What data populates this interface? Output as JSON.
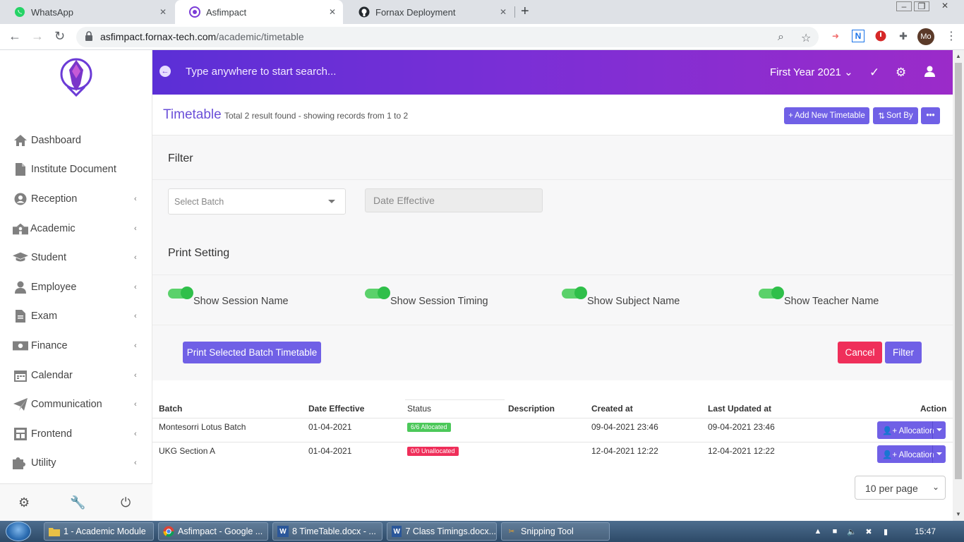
{
  "browser": {
    "tabs": [
      {
        "title": "WhatsApp",
        "icon": "whatsapp-icon"
      },
      {
        "title": "Asfimpact",
        "icon": "asfimpact-icon"
      },
      {
        "title": "Fornax Deployment",
        "icon": "github-icon"
      }
    ],
    "url_domain": "asfimpact.fornax-tech.com",
    "url_path": "/academic/timetable",
    "profile_initials": "Mo"
  },
  "topbar": {
    "search_placeholder": "Type anywhere to start search...",
    "year": "First Year 2021"
  },
  "sidebar": {
    "items": [
      {
        "label": "Dashboard",
        "icon": "home-icon",
        "has_submenu": false
      },
      {
        "label": "Institute Document",
        "icon": "document-icon",
        "has_submenu": false
      },
      {
        "label": "Reception",
        "icon": "user-circle-icon",
        "has_submenu": true
      },
      {
        "label": "Academic",
        "icon": "school-icon",
        "has_submenu": true
      },
      {
        "label": "Student",
        "icon": "graduation-cap-icon",
        "has_submenu": true
      },
      {
        "label": "Employee",
        "icon": "user-tie-icon",
        "has_submenu": true
      },
      {
        "label": "Exam",
        "icon": "file-icon",
        "has_submenu": true
      },
      {
        "label": "Finance",
        "icon": "money-icon",
        "has_submenu": true
      },
      {
        "label": "Calendar",
        "icon": "calendar-icon",
        "has_submenu": true
      },
      {
        "label": "Communication",
        "icon": "paper-plane-icon",
        "has_submenu": true
      },
      {
        "label": "Frontend",
        "icon": "folder-icon",
        "has_submenu": true
      },
      {
        "label": "Utility",
        "icon": "puzzle-icon",
        "has_submenu": true
      }
    ]
  },
  "page": {
    "title": "Timetable",
    "subtitle": "Total 2 result found - showing records from 1 to 2",
    "add_button": "Add New Timetable",
    "sort_button": "Sort By"
  },
  "filter": {
    "title": "Filter",
    "batch_placeholder": "Select Batch",
    "date_placeholder": "Date Effective"
  },
  "print_setting": {
    "title": "Print Setting",
    "toggles": [
      {
        "label": "Show Session Name",
        "on": true
      },
      {
        "label": "Show Session Timing",
        "on": true
      },
      {
        "label": "Show Subject Name",
        "on": true
      },
      {
        "label": "Show Teacher Name",
        "on": true
      }
    ]
  },
  "actions": {
    "print": "Print Selected Batch Timetable",
    "cancel": "Cancel",
    "filter": "Filter"
  },
  "table": {
    "headers": [
      "Batch",
      "Date Effective",
      "Status",
      "Description",
      "Created at",
      "Last Updated at",
      "Action"
    ],
    "rows": [
      {
        "batch": "Montesorri Lotus Batch",
        "date_effective": "01-04-2021",
        "status": "6/6 Allocated",
        "status_color": "#4cc85a",
        "description": "",
        "created_at": "09-04-2021 23:46",
        "updated_at": "09-04-2021 23:46",
        "action": "Allocation"
      },
      {
        "batch": "UKG Section A",
        "date_effective": "01-04-2021",
        "status": "0/0 Unallocated",
        "status_color": "#ef2f5a",
        "description": "",
        "created_at": "12-04-2021 12:22",
        "updated_at": "12-04-2021 12:22",
        "action": "Allocation"
      }
    ],
    "per_page": "10 per page"
  },
  "taskbar": {
    "tasks": [
      {
        "label": "1 - Academic Module",
        "icon": "folder-icon"
      },
      {
        "label": "Asfimpact - Google ...",
        "icon": "chrome-icon"
      },
      {
        "label": "8 TimeTable.docx - ...",
        "icon": "word-icon"
      },
      {
        "label": "7 Class Timings.docx...",
        "icon": "word-icon"
      },
      {
        "label": "Snipping Tool",
        "icon": "scissors-icon"
      }
    ],
    "clock": "15:47"
  },
  "colors": {
    "accent": "#7060e6",
    "header_gradient_start": "#5b2fd6",
    "header_gradient_end": "#9b2bc9",
    "cancel": "#ef2f5a",
    "toggle_on": "#2fbf4a"
  }
}
